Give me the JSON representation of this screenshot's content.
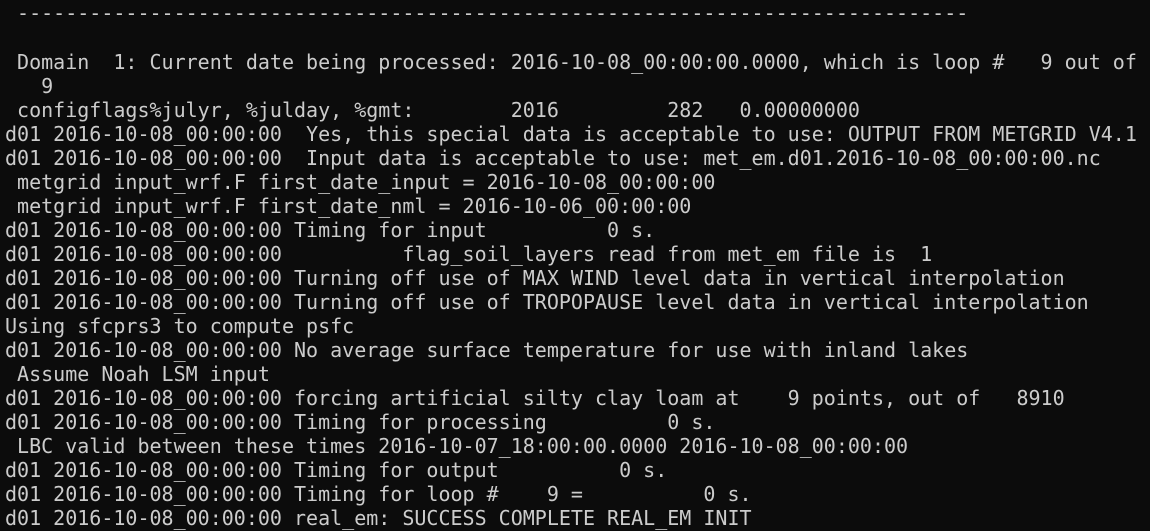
{
  "terminal": {
    "lines": [
      " -------------------------------------------------------------------------------",
      "",
      " Domain  1: Current date being processed: 2016-10-08_00:00:00.0000, which is loop #   9 out of",
      "   9",
      " configflags%julyr, %julday, %gmt:        2016         282   0.00000000",
      "d01 2016-10-08_00:00:00  Yes, this special data is acceptable to use: OUTPUT FROM METGRID V4.1",
      "d01 2016-10-08_00:00:00  Input data is acceptable to use: met_em.d01.2016-10-08_00:00:00.nc",
      " metgrid input_wrf.F first_date_input = 2016-10-08_00:00:00",
      " metgrid input_wrf.F first_date_nml = 2016-10-06_00:00:00",
      "d01 2016-10-08_00:00:00 Timing for input          0 s.",
      "d01 2016-10-08_00:00:00          flag_soil_layers read from met_em file is  1",
      "d01 2016-10-08_00:00:00 Turning off use of MAX WIND level data in vertical interpolation",
      "d01 2016-10-08_00:00:00 Turning off use of TROPOPAUSE level data in vertical interpolation",
      "Using sfcprs3 to compute psfc",
      "d01 2016-10-08_00:00:00 No average surface temperature for use with inland lakes",
      " Assume Noah LSM input",
      "d01 2016-10-08_00:00:00 forcing artificial silty clay loam at    9 points, out of   8910",
      "d01 2016-10-08_00:00:00 Timing for processing          0 s.",
      " LBC valid between these times 2016-10-07_18:00:00.0000 2016-10-08_00:00:00",
      "d01 2016-10-08_00:00:00 Timing for output          0 s.",
      "d01 2016-10-08_00:00:00 Timing for loop #    9 =          0 s.",
      "d01 2016-10-08_00:00:00 real_em: SUCCESS COMPLETE REAL_EM INIT"
    ]
  }
}
